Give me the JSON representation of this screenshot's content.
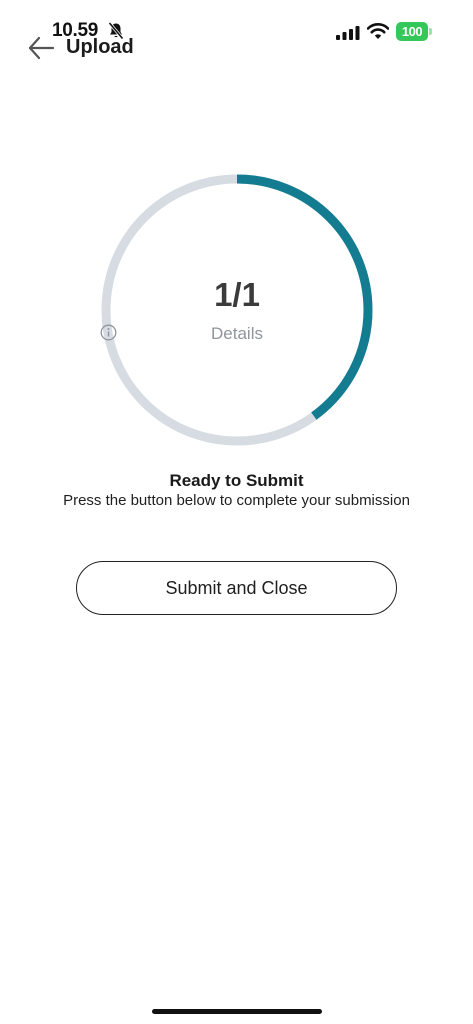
{
  "status_bar": {
    "time": "10.59",
    "battery_level": "100",
    "icons": [
      "bell-slash-icon",
      "signal-icon",
      "wifi-icon",
      "battery-icon"
    ],
    "battery_color": "#34c759"
  },
  "header": {
    "title": "Upload",
    "back_icon": "arrow-left-icon"
  },
  "progress": {
    "count_label": "1/1",
    "caption": "Details",
    "caption_icon": "info-icon",
    "fraction": 0.4,
    "track_color": "#d6dce2",
    "fill_color": "#137c91"
  },
  "message": {
    "title": "Ready to Submit",
    "subtitle": "Press the button below to complete your submission"
  },
  "actions": {
    "submit_label": "Submit and Close"
  }
}
